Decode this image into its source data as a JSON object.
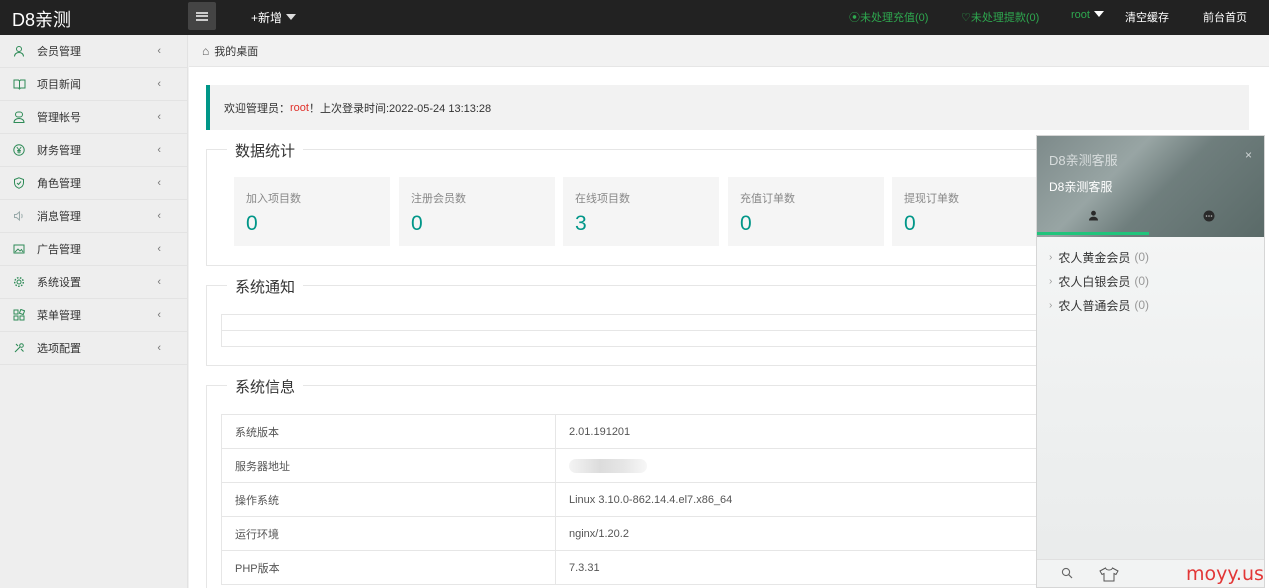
{
  "topbar": {
    "logo": "D8亲测",
    "add_new": "+新增",
    "pending_recharge": "⦿未处理充值(0)",
    "pending_withdraw": "♡未处理提款(0)",
    "user": "root",
    "clear_cache": "清空缓存",
    "front_home": "前台首页"
  },
  "sidebar": {
    "items": [
      {
        "label": "会员管理",
        "icon": "user-icon"
      },
      {
        "label": "项目新闻",
        "icon": "book-icon"
      },
      {
        "label": "管理帐号",
        "icon": "admin-icon"
      },
      {
        "label": "财务管理",
        "icon": "yen-icon"
      },
      {
        "label": "角色管理",
        "icon": "shield-icon"
      },
      {
        "label": "消息管理",
        "icon": "speaker-icon"
      },
      {
        "label": "广告管理",
        "icon": "image-icon"
      },
      {
        "label": "系统设置",
        "icon": "gear-icon"
      },
      {
        "label": "菜单管理",
        "icon": "grid-icon"
      },
      {
        "label": "选项配置",
        "icon": "tools-icon"
      }
    ],
    "chevron": "‹"
  },
  "tabbar": {
    "home": "我的桌面",
    "home_icon": "⌂"
  },
  "welcome": {
    "prefix": "欢迎管理员：",
    "user": "root",
    "suffix": "！上次登录时间:2022-05-24 13:13:28"
  },
  "stats": {
    "legend": "数据统计",
    "cards": [
      {
        "label": "加入项目数",
        "value": "0"
      },
      {
        "label": "注册会员数",
        "value": "0"
      },
      {
        "label": "在线项目数",
        "value": "3"
      },
      {
        "label": "充值订单数",
        "value": "0"
      },
      {
        "label": "提现订单数",
        "value": "0"
      }
    ]
  },
  "notice": {
    "legend": "系统通知"
  },
  "sysinfo": {
    "legend": "系统信息",
    "rows": [
      {
        "key": "系统版本",
        "value": "2.01.191201"
      },
      {
        "key": "服务器地址",
        "value": ""
      },
      {
        "key": "操作系统",
        "value": "Linux 3.10.0-862.14.4.el7.x86_64"
      },
      {
        "key": "运行环境",
        "value": "nginx/1.20.2"
      },
      {
        "key": "PHP版本",
        "value": "7.3.31"
      }
    ]
  },
  "chat": {
    "title": "D8亲测客服",
    "subtitle": "D8亲测客服",
    "close": "×",
    "groups": [
      {
        "name": "农人黄金会员",
        "count": "(0)"
      },
      {
        "name": "农人白银会员",
        "count": "(0)"
      },
      {
        "name": "农人普通会员",
        "count": "(0)"
      }
    ]
  },
  "watermark": "moyy.us"
}
